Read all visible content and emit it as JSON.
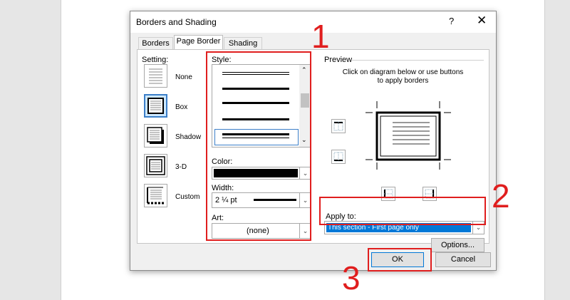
{
  "dialog": {
    "title": "Borders and Shading",
    "help_label": "?",
    "close_label": "✕",
    "tabs": [
      {
        "label": "Borders",
        "active": false
      },
      {
        "label": "Page Border",
        "active": true
      },
      {
        "label": "Shading",
        "active": false
      }
    ],
    "setting": {
      "label": "Setting:",
      "options": [
        {
          "label": "None",
          "selected": false
        },
        {
          "label": "Box",
          "selected": true
        },
        {
          "label": "Shadow",
          "selected": false
        },
        {
          "label": "3-D",
          "selected": false
        },
        {
          "label": "Custom",
          "selected": false
        }
      ]
    },
    "style": {
      "label": "Style:"
    },
    "color": {
      "label": "Color:",
      "value": "#000000"
    },
    "width": {
      "label": "Width:",
      "value": "2 ¼ pt"
    },
    "art": {
      "label": "Art:",
      "value": "(none)"
    },
    "preview": {
      "label": "Preview",
      "hint_line1": "Click on diagram below or use buttons",
      "hint_line2": "to apply borders"
    },
    "apply_to": {
      "label": "Apply to:",
      "value": "This section - First page only"
    },
    "options_button": "Options...",
    "ok_button": "OK",
    "cancel_button": "Cancel"
  },
  "annotations": [
    "1",
    "2",
    "3"
  ],
  "colors": {
    "highlight_red": "#e01e1e",
    "selection_blue": "#0078d7"
  }
}
